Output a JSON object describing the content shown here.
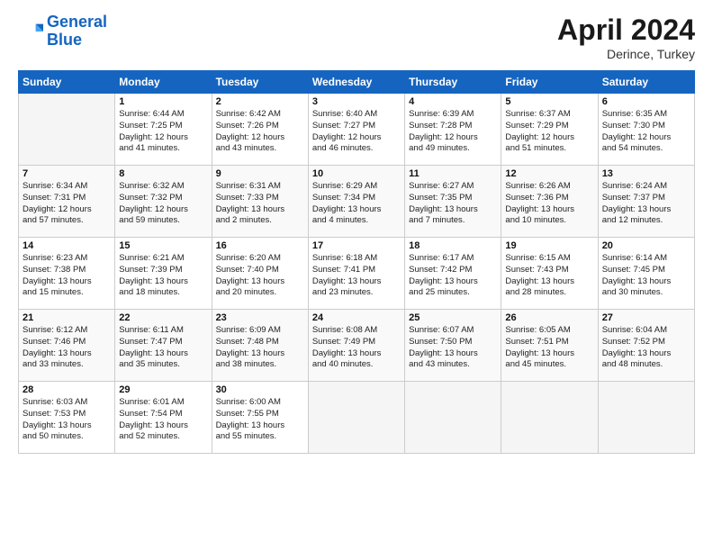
{
  "header": {
    "logo_line1": "General",
    "logo_line2": "Blue",
    "month_year": "April 2024",
    "location": "Derince, Turkey"
  },
  "weekdays": [
    "Sunday",
    "Monday",
    "Tuesday",
    "Wednesday",
    "Thursday",
    "Friday",
    "Saturday"
  ],
  "weeks": [
    [
      {
        "day": "",
        "info": ""
      },
      {
        "day": "1",
        "info": "Sunrise: 6:44 AM\nSunset: 7:25 PM\nDaylight: 12 hours\nand 41 minutes."
      },
      {
        "day": "2",
        "info": "Sunrise: 6:42 AM\nSunset: 7:26 PM\nDaylight: 12 hours\nand 43 minutes."
      },
      {
        "day": "3",
        "info": "Sunrise: 6:40 AM\nSunset: 7:27 PM\nDaylight: 12 hours\nand 46 minutes."
      },
      {
        "day": "4",
        "info": "Sunrise: 6:39 AM\nSunset: 7:28 PM\nDaylight: 12 hours\nand 49 minutes."
      },
      {
        "day": "5",
        "info": "Sunrise: 6:37 AM\nSunset: 7:29 PM\nDaylight: 12 hours\nand 51 minutes."
      },
      {
        "day": "6",
        "info": "Sunrise: 6:35 AM\nSunset: 7:30 PM\nDaylight: 12 hours\nand 54 minutes."
      }
    ],
    [
      {
        "day": "7",
        "info": "Sunrise: 6:34 AM\nSunset: 7:31 PM\nDaylight: 12 hours\nand 57 minutes."
      },
      {
        "day": "8",
        "info": "Sunrise: 6:32 AM\nSunset: 7:32 PM\nDaylight: 12 hours\nand 59 minutes."
      },
      {
        "day": "9",
        "info": "Sunrise: 6:31 AM\nSunset: 7:33 PM\nDaylight: 13 hours\nand 2 minutes."
      },
      {
        "day": "10",
        "info": "Sunrise: 6:29 AM\nSunset: 7:34 PM\nDaylight: 13 hours\nand 4 minutes."
      },
      {
        "day": "11",
        "info": "Sunrise: 6:27 AM\nSunset: 7:35 PM\nDaylight: 13 hours\nand 7 minutes."
      },
      {
        "day": "12",
        "info": "Sunrise: 6:26 AM\nSunset: 7:36 PM\nDaylight: 13 hours\nand 10 minutes."
      },
      {
        "day": "13",
        "info": "Sunrise: 6:24 AM\nSunset: 7:37 PM\nDaylight: 13 hours\nand 12 minutes."
      }
    ],
    [
      {
        "day": "14",
        "info": "Sunrise: 6:23 AM\nSunset: 7:38 PM\nDaylight: 13 hours\nand 15 minutes."
      },
      {
        "day": "15",
        "info": "Sunrise: 6:21 AM\nSunset: 7:39 PM\nDaylight: 13 hours\nand 18 minutes."
      },
      {
        "day": "16",
        "info": "Sunrise: 6:20 AM\nSunset: 7:40 PM\nDaylight: 13 hours\nand 20 minutes."
      },
      {
        "day": "17",
        "info": "Sunrise: 6:18 AM\nSunset: 7:41 PM\nDaylight: 13 hours\nand 23 minutes."
      },
      {
        "day": "18",
        "info": "Sunrise: 6:17 AM\nSunset: 7:42 PM\nDaylight: 13 hours\nand 25 minutes."
      },
      {
        "day": "19",
        "info": "Sunrise: 6:15 AM\nSunset: 7:43 PM\nDaylight: 13 hours\nand 28 minutes."
      },
      {
        "day": "20",
        "info": "Sunrise: 6:14 AM\nSunset: 7:45 PM\nDaylight: 13 hours\nand 30 minutes."
      }
    ],
    [
      {
        "day": "21",
        "info": "Sunrise: 6:12 AM\nSunset: 7:46 PM\nDaylight: 13 hours\nand 33 minutes."
      },
      {
        "day": "22",
        "info": "Sunrise: 6:11 AM\nSunset: 7:47 PM\nDaylight: 13 hours\nand 35 minutes."
      },
      {
        "day": "23",
        "info": "Sunrise: 6:09 AM\nSunset: 7:48 PM\nDaylight: 13 hours\nand 38 minutes."
      },
      {
        "day": "24",
        "info": "Sunrise: 6:08 AM\nSunset: 7:49 PM\nDaylight: 13 hours\nand 40 minutes."
      },
      {
        "day": "25",
        "info": "Sunrise: 6:07 AM\nSunset: 7:50 PM\nDaylight: 13 hours\nand 43 minutes."
      },
      {
        "day": "26",
        "info": "Sunrise: 6:05 AM\nSunset: 7:51 PM\nDaylight: 13 hours\nand 45 minutes."
      },
      {
        "day": "27",
        "info": "Sunrise: 6:04 AM\nSunset: 7:52 PM\nDaylight: 13 hours\nand 48 minutes."
      }
    ],
    [
      {
        "day": "28",
        "info": "Sunrise: 6:03 AM\nSunset: 7:53 PM\nDaylight: 13 hours\nand 50 minutes."
      },
      {
        "day": "29",
        "info": "Sunrise: 6:01 AM\nSunset: 7:54 PM\nDaylight: 13 hours\nand 52 minutes."
      },
      {
        "day": "30",
        "info": "Sunrise: 6:00 AM\nSunset: 7:55 PM\nDaylight: 13 hours\nand 55 minutes."
      },
      {
        "day": "",
        "info": ""
      },
      {
        "day": "",
        "info": ""
      },
      {
        "day": "",
        "info": ""
      },
      {
        "day": "",
        "info": ""
      }
    ]
  ]
}
